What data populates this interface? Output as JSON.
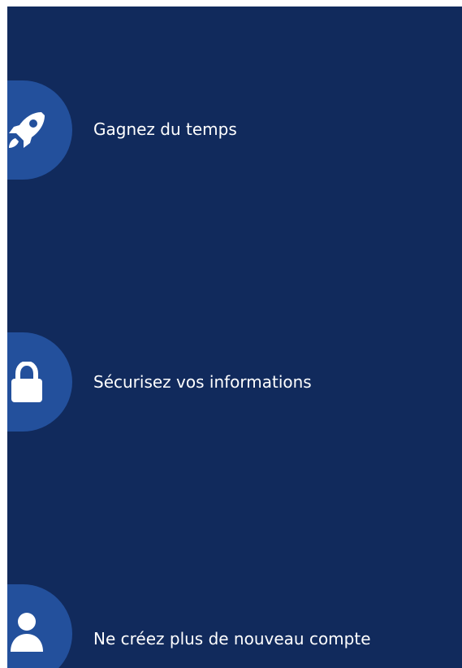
{
  "theme": {
    "panel_background": "#112a5c",
    "icon_circle": "#23509c",
    "text_color": "#ffffff"
  },
  "features": [
    {
      "icon": "rocket-icon",
      "label": "Gagnez du temps"
    },
    {
      "icon": "lock-icon",
      "label": "Sécurisez vos informations"
    },
    {
      "icon": "user-icon",
      "label": "Ne créez plus de nouveau compte"
    }
  ]
}
